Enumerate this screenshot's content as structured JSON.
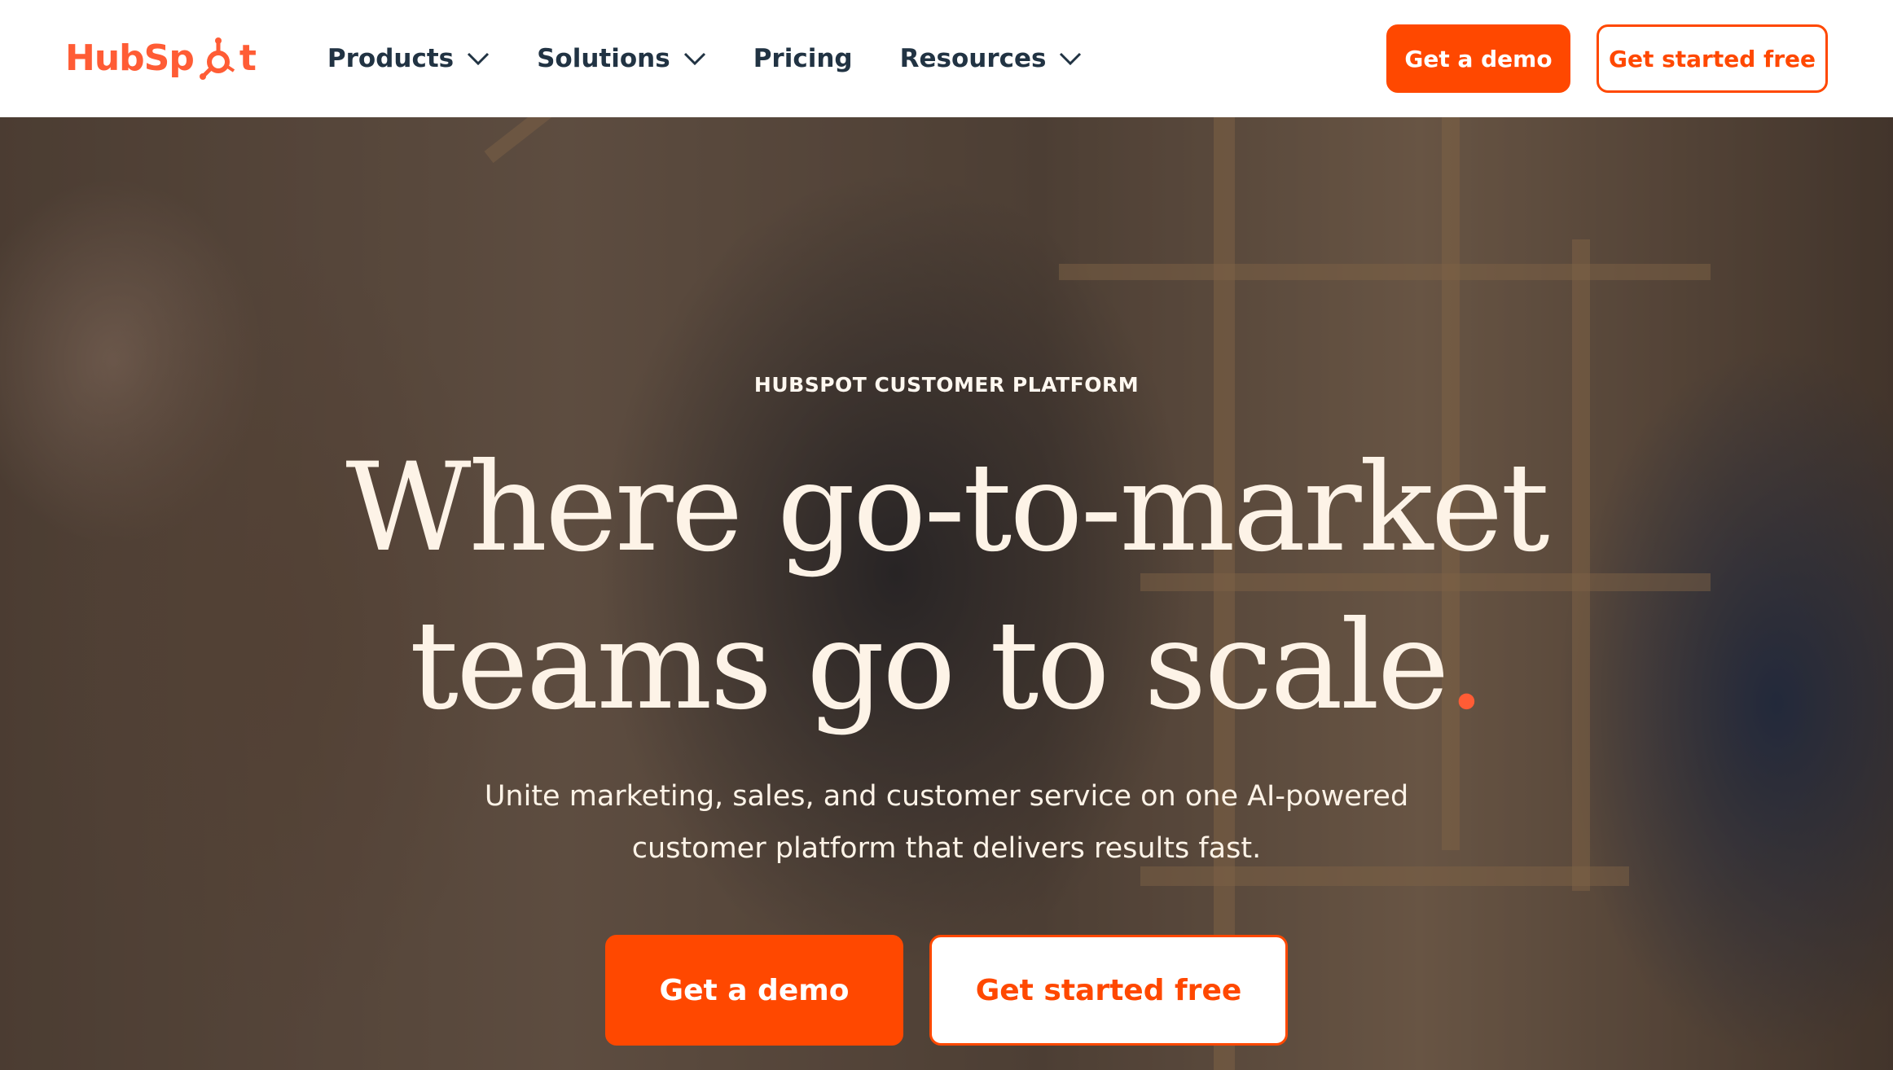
{
  "brand": {
    "logo_text_a": "HubSp",
    "logo_text_b": "t",
    "accent_color": "#ff4800",
    "text_color": "#213343"
  },
  "nav": {
    "items": [
      {
        "label": "Products",
        "has_dropdown": true
      },
      {
        "label": "Solutions",
        "has_dropdown": true
      },
      {
        "label": "Pricing",
        "has_dropdown": false
      },
      {
        "label": "Resources",
        "has_dropdown": true
      }
    ]
  },
  "header_actions": {
    "demo_label": "Get a demo",
    "free_label": "Get started free"
  },
  "hero": {
    "eyebrow": "HUBSPOT CUSTOMER PLATFORM",
    "headline_line1": "Where go-to-market",
    "headline_line2": "teams go to scale",
    "headline_dot": ".",
    "subhead_line1": "Unite marketing, sales, and customer service on one AI-powered",
    "subhead_line2": "customer platform that delivers results fast.",
    "demo_label": "Get a demo",
    "free_label": "Get started free"
  }
}
